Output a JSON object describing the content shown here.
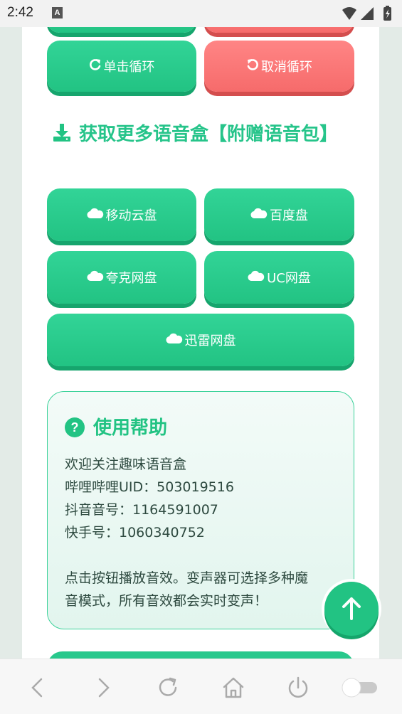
{
  "status_bar": {
    "time": "2:42",
    "notif_letter": "A"
  },
  "buttons": {
    "single_loop": "单击循环",
    "cancel_loop": "取消循环"
  },
  "section": {
    "title": "获取更多语音盒【附赠语音包】"
  },
  "cloud_buttons": {
    "mobile_cloud": "移动云盘",
    "baidu": "百度盘",
    "quark": "夸克网盘",
    "uc": "UC网盘",
    "xunlei": "迅雷网盘"
  },
  "help": {
    "title": "使用帮助",
    "line1": "欢迎关注趣味语音盒",
    "line2": "哔哩哔哩UID：503019516",
    "line3": "抖音音号：1164591007",
    "line4": "快手号：1060340752",
    "line5": "点击按钮播放音效。变声器可选择多种魔",
    "line6": "音模式，所有音效都会实时变声！"
  },
  "colors": {
    "accent": "#22c383",
    "danger": "#f66b6b"
  }
}
